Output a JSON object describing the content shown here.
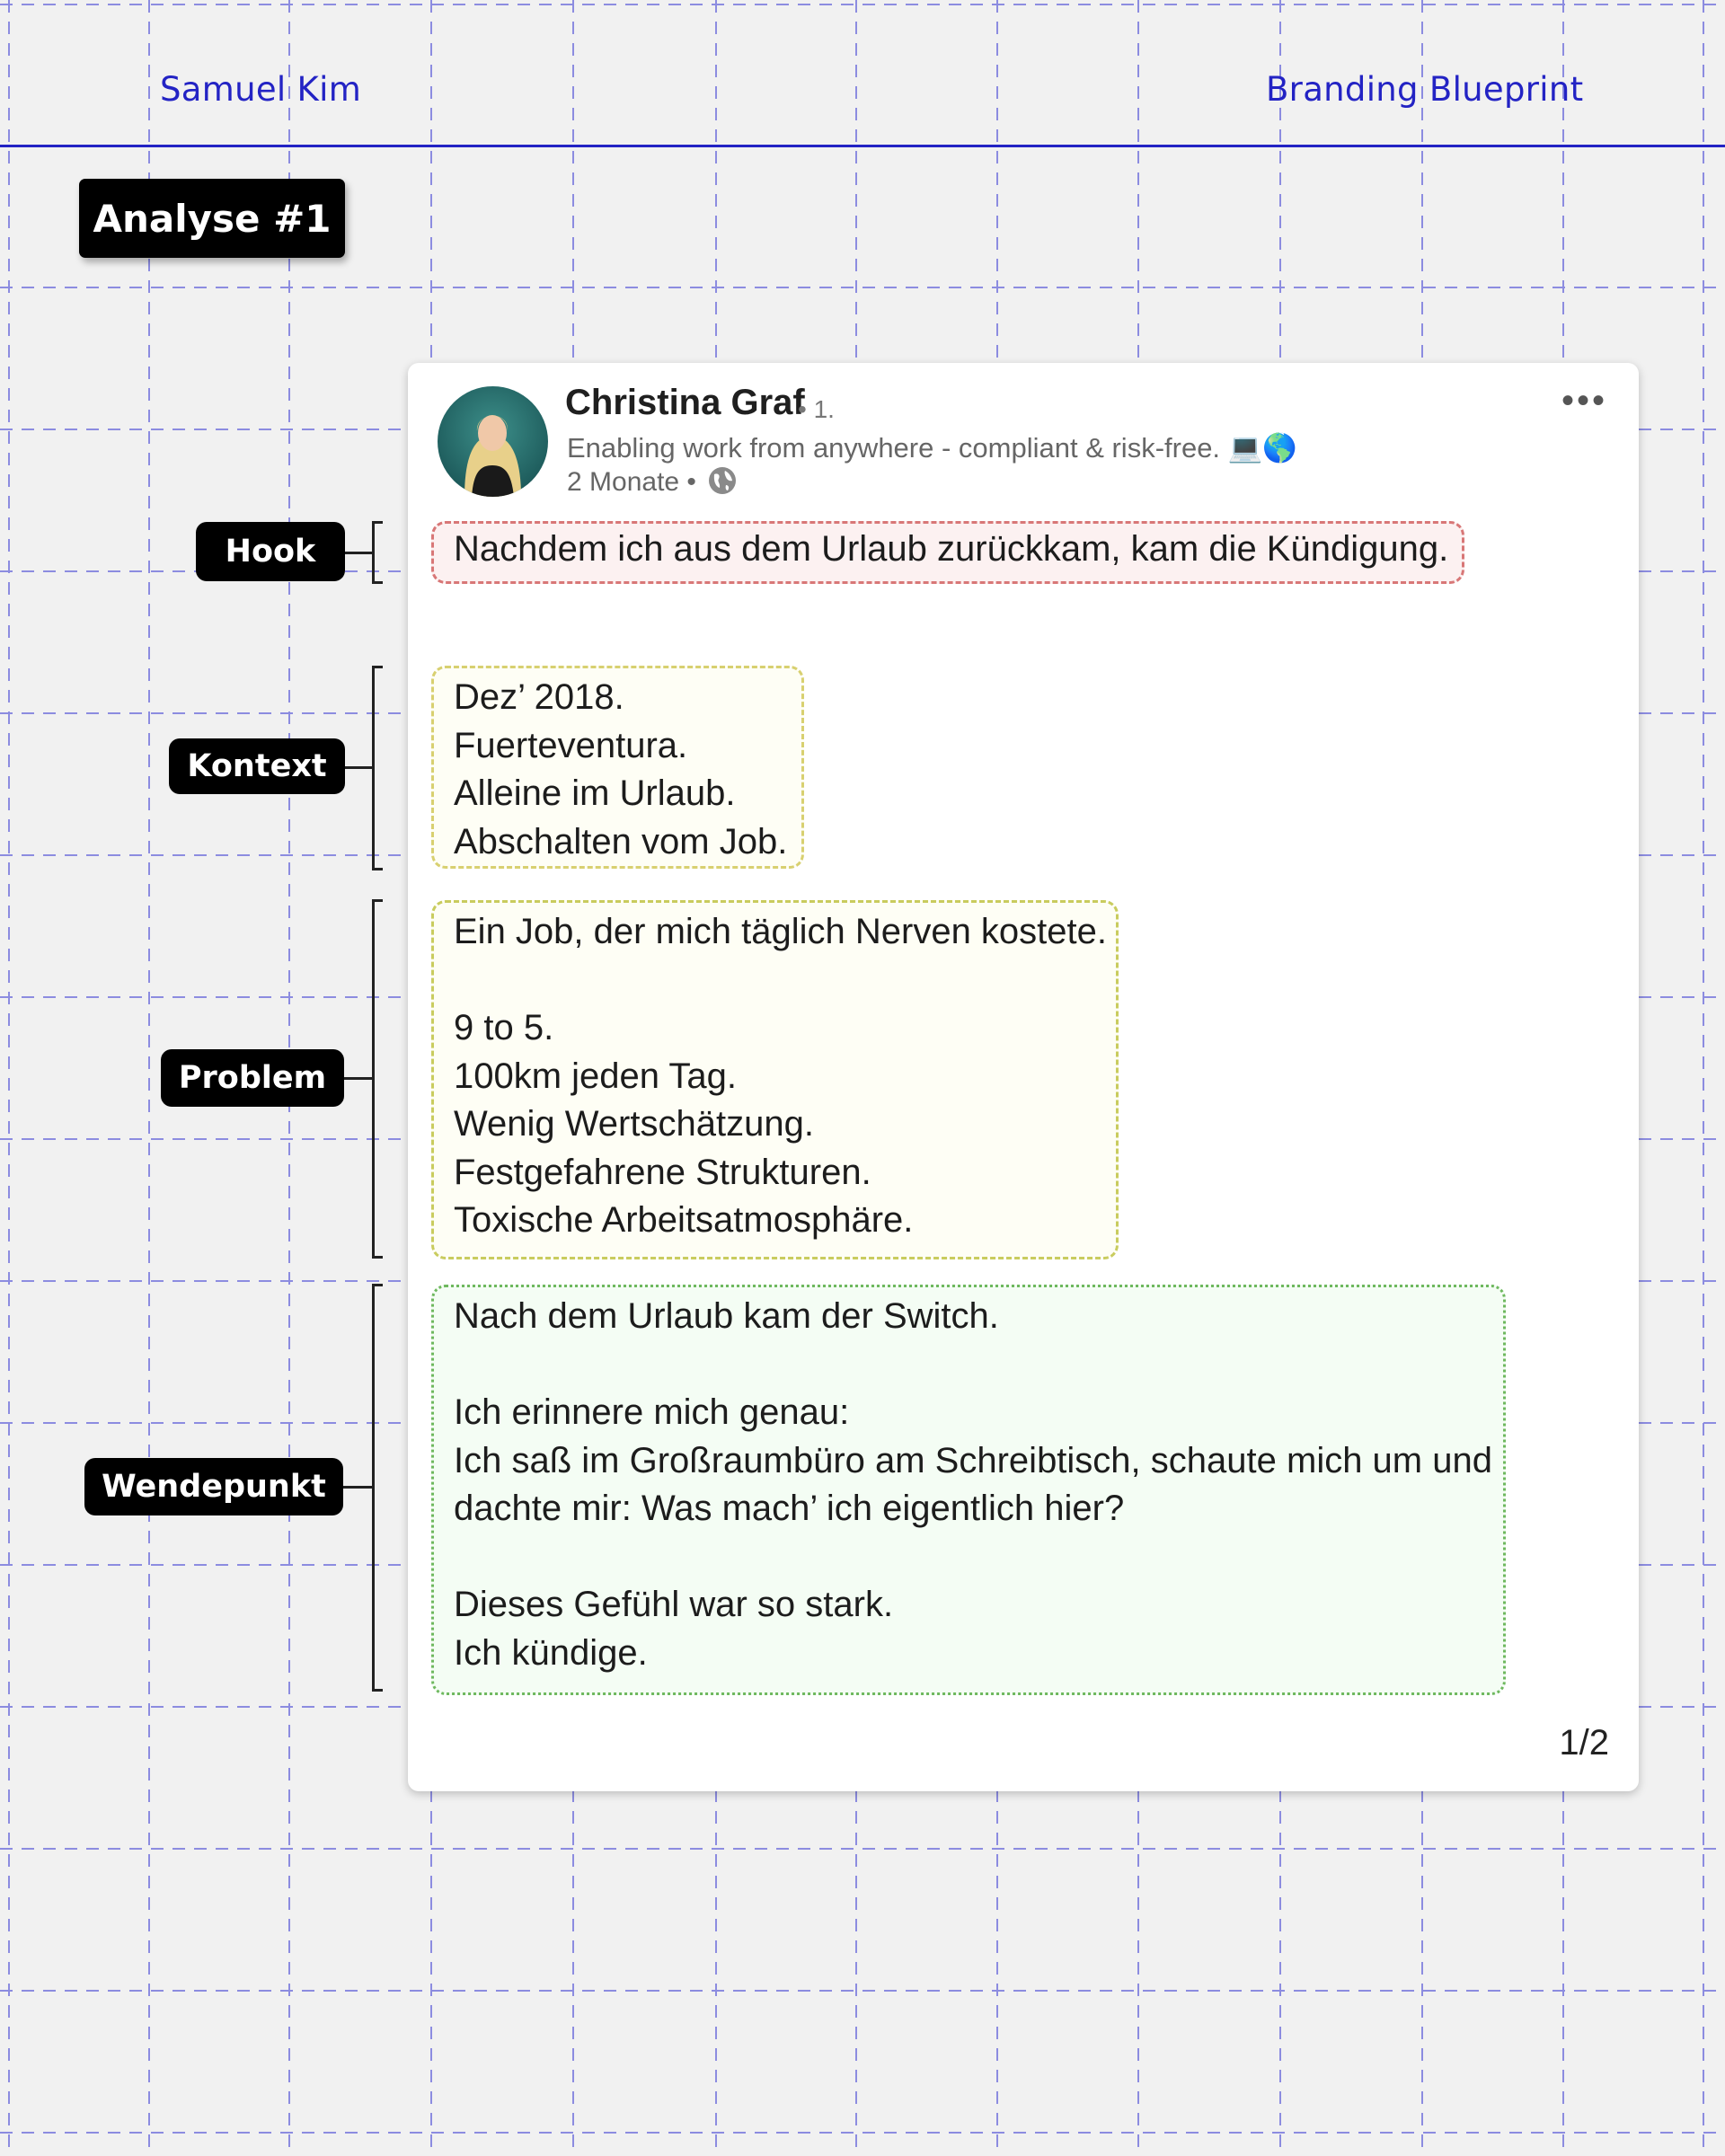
{
  "header": {
    "author_name": "Samuel Kim",
    "brand": "Branding Blueprint"
  },
  "title_badge": "Analyse #1",
  "labels": {
    "hook": "Hook",
    "kontext": "Kontext",
    "problem": "Problem",
    "wendepunkt": "Wendepunkt"
  },
  "post": {
    "author": "Christina Graf",
    "connection_degree": "• 1.",
    "headline": "Enabling work from anywhere - compliant & risk-free. 💻🌎",
    "timestamp": "2 Monate •",
    "more_icon": "ellipsis-icon",
    "visibility_icon": "globe-icon",
    "hook_lines": [
      "Nachdem ich aus dem Urlaub zurückkam, kam die Kündigung."
    ],
    "kontext_lines": [
      "Dez’ 2018.",
      "Fuerteventura.",
      "Alleine im Urlaub.",
      "Abschalten vom Job."
    ],
    "problem_lines": [
      "Ein Job, der mich täglich Nerven kostete.",
      "",
      "9 to 5.",
      "100km jeden Tag.",
      "Wenig Wertschätzung.",
      "Festgefahrene Strukturen.",
      "Toxische Arbeitsatmosphäre."
    ],
    "wendepunkt_lines": [
      "Nach dem Urlaub kam der Switch.",
      "",
      "Ich erinnere mich genau:",
      "Ich saß im Großraumbüro am Schreibtisch, schaute mich um und",
      "dachte mir: Was mach’ ich eigentlich hier?",
      "",
      "Dieses Gefühl war so stark.",
      "Ich kündige."
    ],
    "pager": "1/2"
  },
  "colors": {
    "accent_blue": "#2323c4",
    "hook_border": "#d87777",
    "kontext_border": "#d8d070",
    "problem_border": "#c9cc5e",
    "wendepunkt_border": "#6eb85e"
  }
}
